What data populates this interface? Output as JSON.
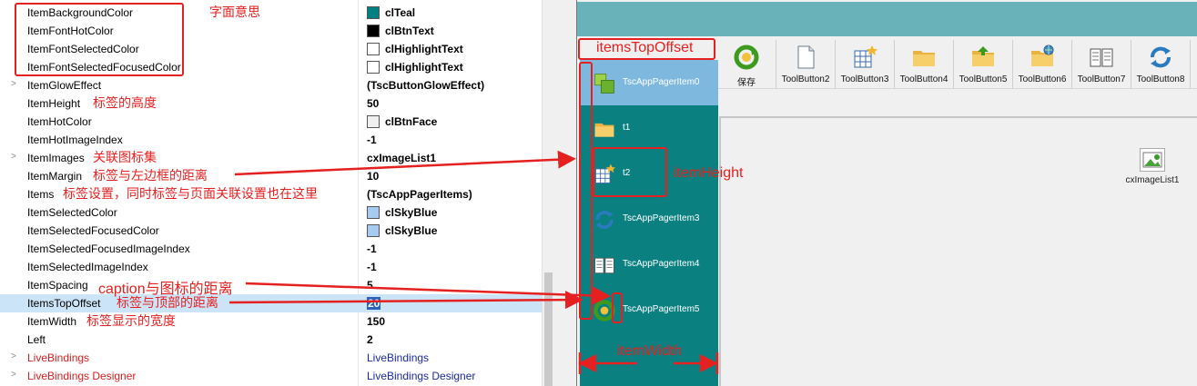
{
  "inspector": {
    "rows": [
      {
        "expand": "",
        "name": "ItemBackgroundColor",
        "value": "clTeal",
        "swatch": "#008080",
        "style": "bold",
        "note": "字面意思"
      },
      {
        "expand": "",
        "name": "ItemFontHotColor",
        "value": "clBtnText",
        "swatch": "#000000",
        "style": "bold",
        "note": ""
      },
      {
        "expand": "",
        "name": "ItemFontSelectedColor",
        "value": "clHighlightText",
        "swatch": "#ffffff",
        "style": "bold",
        "note": ""
      },
      {
        "expand": "",
        "name": "ItemFontSelectedFocusedColor",
        "value": "clHighlightText",
        "swatch": "#ffffff",
        "style": "bold",
        "note": ""
      },
      {
        "expand": ">",
        "name": "ItemGlowEffect",
        "value": "(TscButtonGlowEffect)",
        "swatch": "",
        "style": "bold",
        "note": ""
      },
      {
        "expand": "",
        "name": "ItemHeight",
        "value": "50",
        "swatch": "",
        "style": "bold",
        "note": "标签的高度"
      },
      {
        "expand": "",
        "name": "ItemHotColor",
        "value": "clBtnFace",
        "swatch": "#f0f0f0",
        "style": "bold",
        "note": ""
      },
      {
        "expand": "",
        "name": "ItemHotImageIndex",
        "value": "-1",
        "swatch": "",
        "style": "bold",
        "note": ""
      },
      {
        "expand": ">",
        "name": "ItemImages",
        "value": "cxImageList1",
        "swatch": "",
        "style": "bold",
        "note": "关联图标集"
      },
      {
        "expand": "",
        "name": "ItemMargin",
        "value": "10",
        "swatch": "",
        "style": "bold",
        "note": "标签与左边框的距离"
      },
      {
        "expand": "",
        "name": "Items",
        "value": "(TscAppPagerItems)",
        "swatch": "",
        "style": "bold",
        "note": "标签设置，同时标签与页面关联设置也在这里"
      },
      {
        "expand": "",
        "name": "ItemSelectedColor",
        "value": "clSkyBlue",
        "swatch": "#a6caf0",
        "style": "bold",
        "note": ""
      },
      {
        "expand": "",
        "name": "ItemSelectedFocusedColor",
        "value": "clSkyBlue",
        "swatch": "#a6caf0",
        "style": "bold",
        "note": ""
      },
      {
        "expand": "",
        "name": "ItemSelectedFocusedImageIndex",
        "value": "-1",
        "swatch": "",
        "style": "bold",
        "note": ""
      },
      {
        "expand": "",
        "name": "ItemSelectedImageIndex",
        "value": "-1",
        "swatch": "",
        "style": "bold",
        "note": ""
      },
      {
        "expand": "",
        "name": "ItemSpacing",
        "value": "5",
        "swatch": "",
        "style": "bold",
        "note": "caption与图标的距离"
      },
      {
        "expand": "",
        "name": "ItemsTopOffset",
        "value": "20",
        "swatch": "",
        "style": "selected",
        "note": "标签与顶部的距离"
      },
      {
        "expand": "",
        "name": "ItemWidth",
        "value": "150",
        "swatch": "",
        "style": "bold",
        "note": "标签显示的宽度"
      },
      {
        "expand": "",
        "name": "Left",
        "value": "2",
        "swatch": "",
        "style": "bold",
        "note": ""
      },
      {
        "expand": ">",
        "name": "LiveBindings",
        "value": "LiveBindings",
        "swatch": "",
        "style": "link",
        "note": ""
      },
      {
        "expand": ">",
        "name": "LiveBindings Designer",
        "value": "LiveBindings Designer",
        "swatch": "",
        "style": "link",
        "note": ""
      }
    ]
  },
  "toolbar": {
    "buttons": [
      {
        "label": "保存",
        "icon": "save-refresh-icon"
      },
      {
        "label": "ToolButton2",
        "icon": "blank-document-icon"
      },
      {
        "label": "ToolButton3",
        "icon": "new-table-icon"
      },
      {
        "label": "ToolButton4",
        "icon": "folder-icon"
      },
      {
        "label": "ToolButton5",
        "icon": "folder-up-icon"
      },
      {
        "label": "ToolButton6",
        "icon": "folder-globe-icon"
      },
      {
        "label": "ToolButton7",
        "icon": "book-icon"
      },
      {
        "label": "ToolButton8",
        "icon": "refresh-icon"
      }
    ]
  },
  "pager": {
    "items": [
      {
        "label": "TscAppPagerItem0",
        "icon": "green-blocks-icon",
        "selected": true
      },
      {
        "label": "t1",
        "icon": "folder-icon",
        "selected": false
      },
      {
        "label": "t2",
        "icon": "new-table-icon",
        "selected": false
      },
      {
        "label": "TscAppPagerItem3",
        "icon": "refresh-icon",
        "selected": false
      },
      {
        "label": "TscAppPagerItem4",
        "icon": "book-icon",
        "selected": false
      },
      {
        "label": "TscAppPagerItem5",
        "icon": "save-refresh-icon",
        "selected": false
      }
    ]
  },
  "component": {
    "label": "cxImageList1",
    "icon": "image-list-icon"
  },
  "annotations": {
    "items_top_offset": "itemsTopOffset",
    "item_height": "itemHeight",
    "item_width": "itemWidth"
  },
  "colors": {
    "teal": "#0b8080",
    "title_bar": "#6ab2ba",
    "annotation": "#e52020",
    "selected_item": "#7fb8de"
  }
}
